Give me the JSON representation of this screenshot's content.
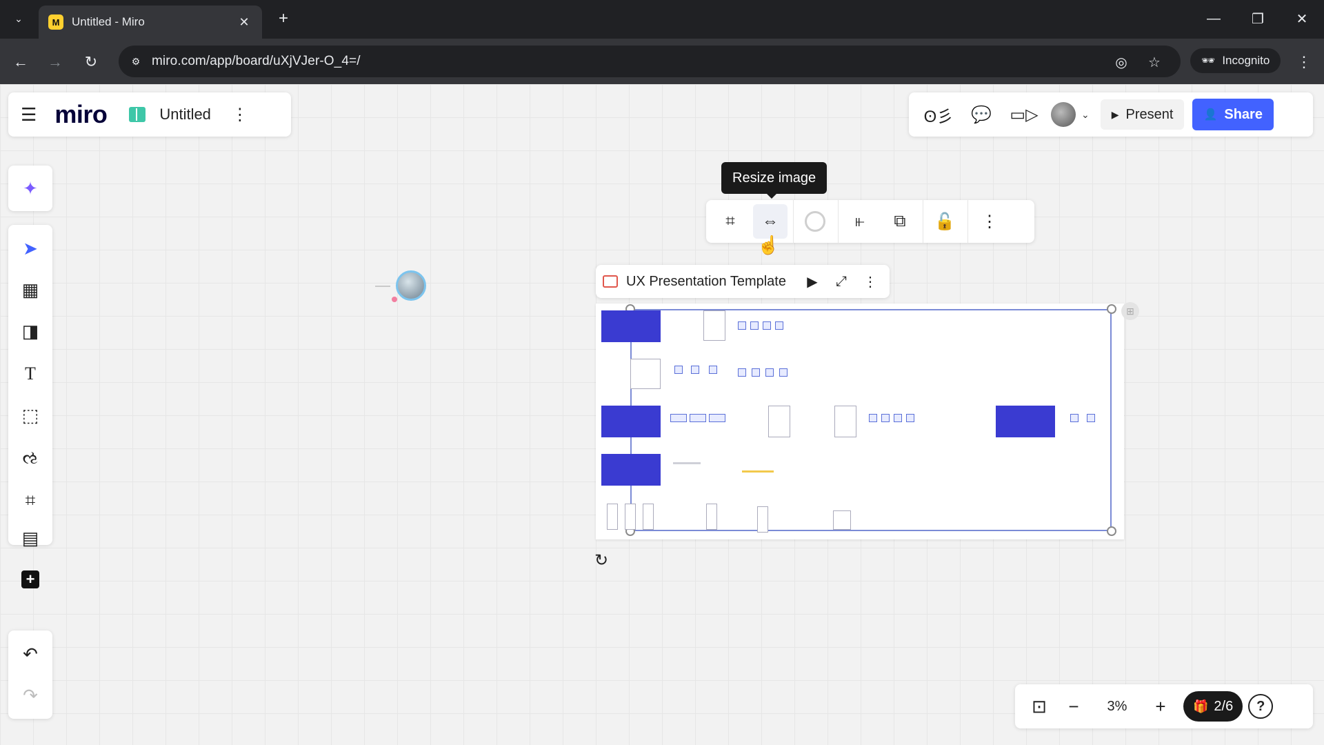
{
  "browser": {
    "tab_title": "Untitled - Miro",
    "tab_favicon_letter": "M",
    "url": "miro.com/app/board/uXjVJer-O_4=/",
    "incognito_label": "Incognito"
  },
  "header": {
    "logo": "miro",
    "board_title": "Untitled",
    "present_label": "Present",
    "share_label": "Share"
  },
  "icons": {
    "hamburger": "☰",
    "board_menu": "⋮",
    "reactions": "ʘ彡",
    "chat": "💬",
    "video": "▭▷",
    "caret": "⌄",
    "present": "▶",
    "share": "👤",
    "ai": "✦",
    "select": "➤",
    "templates": "▦",
    "sticky": "◨",
    "text": "T",
    "shapes": "⬚",
    "pen": "ઌ",
    "frame": "⌗",
    "table": "▤",
    "add": "+",
    "undo": "↶",
    "redo": "↷",
    "crop": "⌗",
    "resize": "⇔",
    "align": "⫦",
    "replace": "⧉",
    "lock": "🔓",
    "more": "⋮",
    "play": "▶",
    "expand": "⤢",
    "rotate": "↻",
    "fit": "⊡",
    "zoom_out": "−",
    "zoom_in": "+",
    "gift": "🎁",
    "help": "?"
  },
  "tooltip": "Resize image",
  "frame": {
    "title": "UX Presentation Template"
  },
  "bottom": {
    "zoom": "3%",
    "apps_count": "2/6"
  },
  "colors": {
    "accent": "#4262ff",
    "miro_yellow": "#ffd02f",
    "slide_blue": "#3a3bd1"
  }
}
